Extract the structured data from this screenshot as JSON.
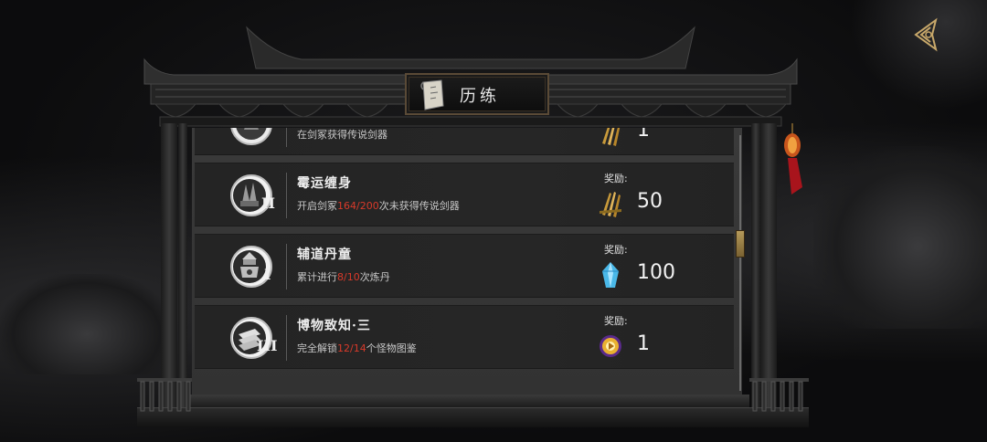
{
  "header": {
    "title": "历练"
  },
  "achievements": [
    {
      "name": "",
      "description": [
        {
          "text": "在剑冢获得传说剑器",
          "hl": false
        }
      ],
      "reward_label": "",
      "reward_icon": "gold-sword-bundle-icon",
      "reward_amount": "1",
      "tier": ""
    },
    {
      "name": "霉运缠身",
      "description": [
        {
          "text": "开启剑冢",
          "hl": false
        },
        {
          "text": "164/200",
          "hl": true
        },
        {
          "text": "次未获得传说剑器",
          "hl": false
        }
      ],
      "reward_label": "奖励:",
      "reward_icon": "gold-sword-bundle-icon",
      "reward_amount": "50",
      "tier": "II"
    },
    {
      "name": "辅道丹童",
      "description": [
        {
          "text": "累计进行",
          "hl": false
        },
        {
          "text": "8/10",
          "hl": true
        },
        {
          "text": "次炼丹",
          "hl": false
        }
      ],
      "reward_label": "奖励:",
      "reward_icon": "blue-crystal-icon",
      "reward_amount": "100",
      "tier": "I"
    },
    {
      "name": "博物致知·三",
      "description": [
        {
          "text": "完全解锁",
          "hl": false
        },
        {
          "text": "12/14",
          "hl": true
        },
        {
          "text": "个怪物图鉴",
          "hl": false
        }
      ],
      "reward_label": "奖励:",
      "reward_icon": "golden-orb-icon",
      "reward_amount": "1",
      "tier": "III"
    }
  ],
  "colors": {
    "highlight": "#d83a2a",
    "accent_gold": "#b59a5a"
  }
}
